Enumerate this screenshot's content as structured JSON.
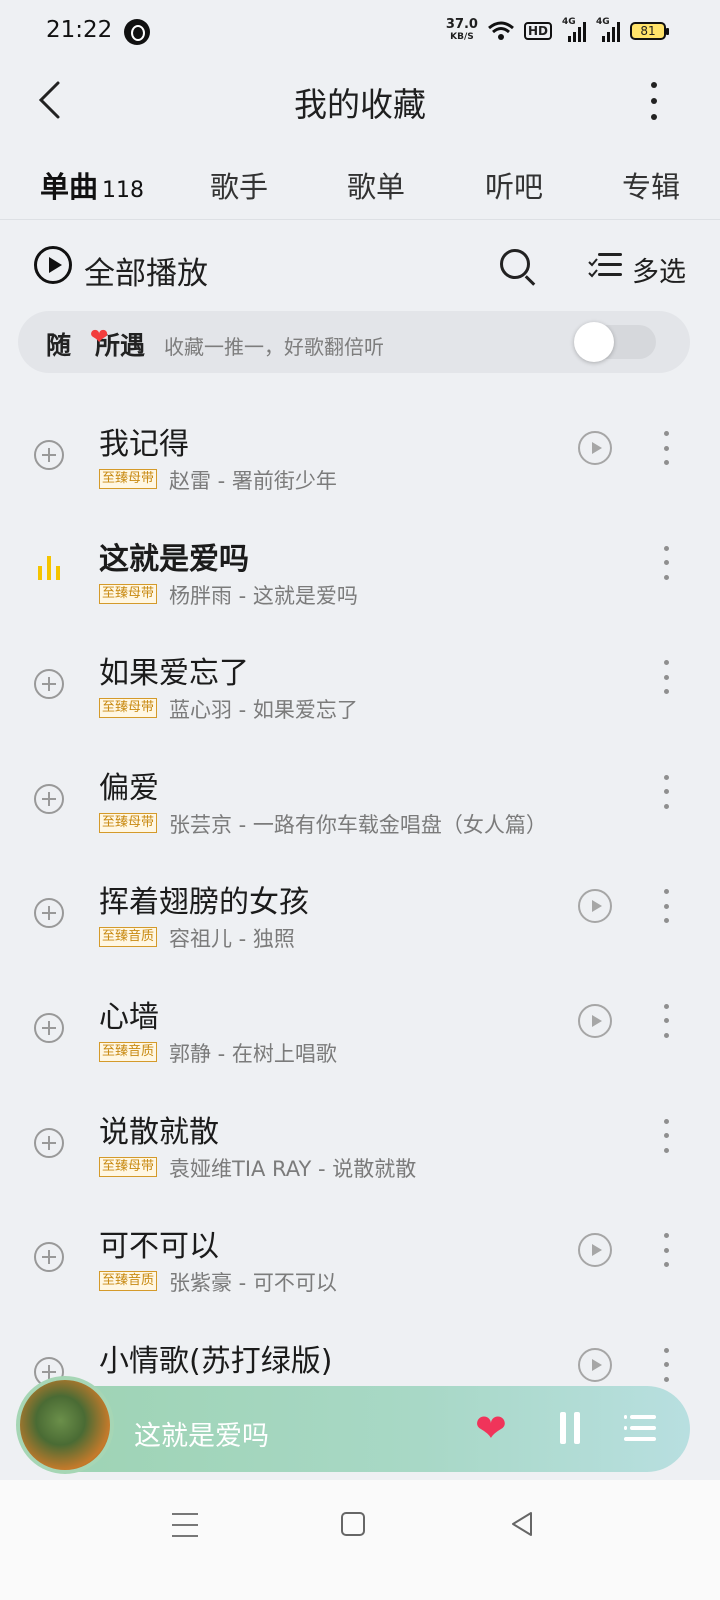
{
  "status_bar": {
    "time": "21:22",
    "net_speed": "37.0",
    "net_speed_unit": "KB/S",
    "hd": "HD",
    "signal1_label": "4G",
    "signal2_label": "4G",
    "battery": "81"
  },
  "header": {
    "title": "我的收藏"
  },
  "tabs": [
    {
      "label": "单曲",
      "count": "118",
      "active": true
    },
    {
      "label": "歌手"
    },
    {
      "label": "歌单"
    },
    {
      "label": "听吧"
    },
    {
      "label": "专辑"
    }
  ],
  "toolbar": {
    "play_all": "全部播放",
    "multi_select": "多选"
  },
  "random_feature": {
    "title_part1": "随",
    "title_part2": "所遇",
    "subtitle": "收藏一推一，好歌翻倍听",
    "enabled": false
  },
  "songs": [
    {
      "title": "我记得",
      "badge": "至臻母带",
      "meta": "赵雷 - 署前街少年",
      "has_play_button": true
    },
    {
      "title": "这就是爱吗",
      "badge": "至臻母带",
      "meta": "杨胖雨 - 这就是爱吗",
      "playing": true,
      "has_play_button": false
    },
    {
      "title": "如果爱忘了",
      "badge": "至臻母带",
      "meta": "蓝心羽 - 如果爱忘了",
      "has_play_button": false
    },
    {
      "title": "偏爱",
      "badge": "至臻母带",
      "meta": "张芸京 - 一路有你车载金唱盘（女人篇）",
      "has_play_button": false
    },
    {
      "title": "挥着翅膀的女孩",
      "badge": "至臻音质",
      "meta": "容祖儿 - 独照",
      "has_play_button": true
    },
    {
      "title": "心墙",
      "badge": "至臻音质",
      "meta": "郭静 - 在树上唱歌",
      "has_play_button": true
    },
    {
      "title": "说散就散",
      "badge": "至臻母带",
      "meta": "袁娅维TIA RAY - 说散就散",
      "has_play_button": false
    },
    {
      "title": "可不可以",
      "badge": "至臻音质",
      "meta": "张紫豪 - 可不可以",
      "has_play_button": true
    },
    {
      "title": "小情歌(苏打绿版)",
      "badge": "",
      "meta": "",
      "has_play_button": true
    }
  ],
  "mini_player": {
    "title": "这就是爱吗",
    "liked": true
  },
  "colors": {
    "accent_yellow": "#ffd400",
    "heart_red": "#f0345a",
    "badge_gold": "#c88a12"
  }
}
